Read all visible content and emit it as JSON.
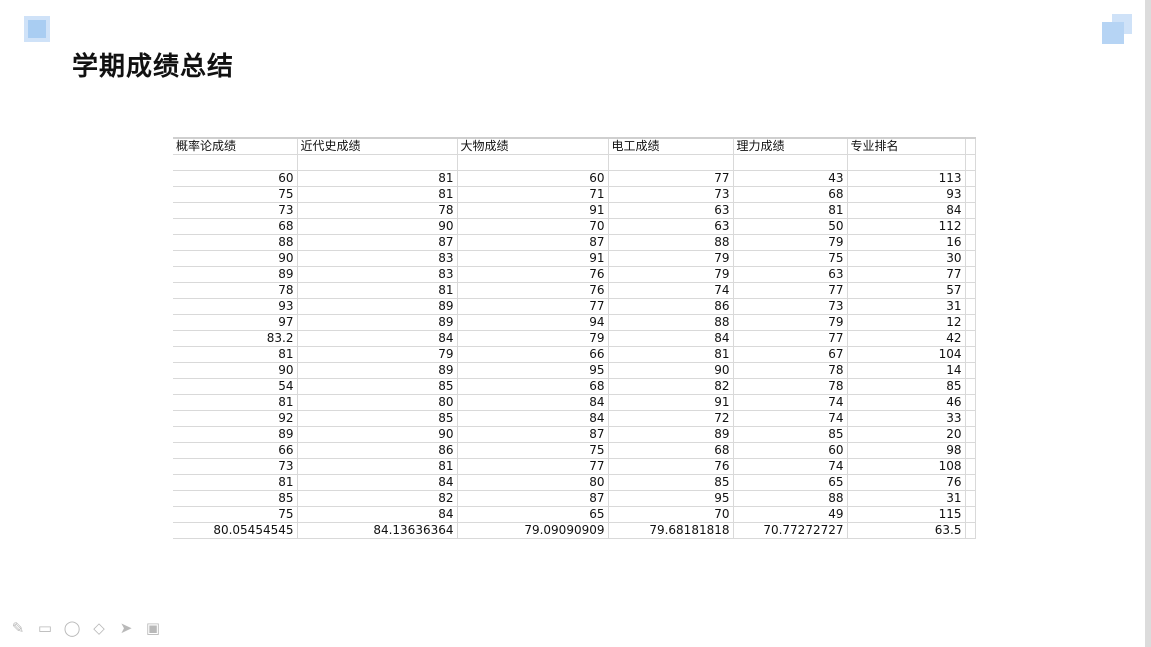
{
  "title": "学期成绩总结",
  "headers": [
    "概率论成绩",
    "近代史成绩",
    "大物成绩",
    "电工成绩",
    "理力成绩",
    "专业排名"
  ],
  "rows": [
    [
      "60",
      "81",
      "60",
      "77",
      "43",
      "113"
    ],
    [
      "75",
      "81",
      "71",
      "73",
      "68",
      "93"
    ],
    [
      "73",
      "78",
      "91",
      "63",
      "81",
      "84"
    ],
    [
      "68",
      "90",
      "70",
      "63",
      "50",
      "112"
    ],
    [
      "88",
      "87",
      "87",
      "88",
      "79",
      "16"
    ],
    [
      "90",
      "83",
      "91",
      "79",
      "75",
      "30"
    ],
    [
      "89",
      "83",
      "76",
      "79",
      "63",
      "77"
    ],
    [
      "78",
      "81",
      "76",
      "74",
      "77",
      "57"
    ],
    [
      "93",
      "89",
      "77",
      "86",
      "73",
      "31"
    ],
    [
      "97",
      "89",
      "94",
      "88",
      "79",
      "12"
    ],
    [
      "83.2",
      "84",
      "79",
      "84",
      "77",
      "42"
    ],
    [
      "81",
      "79",
      "66",
      "81",
      "67",
      "104"
    ],
    [
      "90",
      "89",
      "95",
      "90",
      "78",
      "14"
    ],
    [
      "54",
      "85",
      "68",
      "82",
      "78",
      "85"
    ],
    [
      "81",
      "80",
      "84",
      "91",
      "74",
      "46"
    ],
    [
      "92",
      "85",
      "84",
      "72",
      "74",
      "33"
    ],
    [
      "89",
      "90",
      "87",
      "89",
      "85",
      "20"
    ],
    [
      "66",
      "86",
      "75",
      "68",
      "60",
      "98"
    ],
    [
      "73",
      "81",
      "77",
      "76",
      "74",
      "108"
    ],
    [
      "81",
      "84",
      "80",
      "85",
      "65",
      "76"
    ],
    [
      "85",
      "82",
      "87",
      "95",
      "88",
      "31"
    ],
    [
      "75",
      "84",
      "65",
      "70",
      "49",
      "115"
    ]
  ],
  "averages": [
    "80.05454545",
    "84.13636364",
    "79.09090909",
    "79.68181818",
    "70.77272727",
    "63.5"
  ],
  "toolbar": {
    "icons": [
      "pen-icon",
      "marker-icon",
      "lasso-icon",
      "eraser-icon",
      "pointer-icon",
      "screen-icon"
    ]
  },
  "colors": {
    "accent": "#a9cdf2",
    "grid": "#d9d9d9"
  }
}
